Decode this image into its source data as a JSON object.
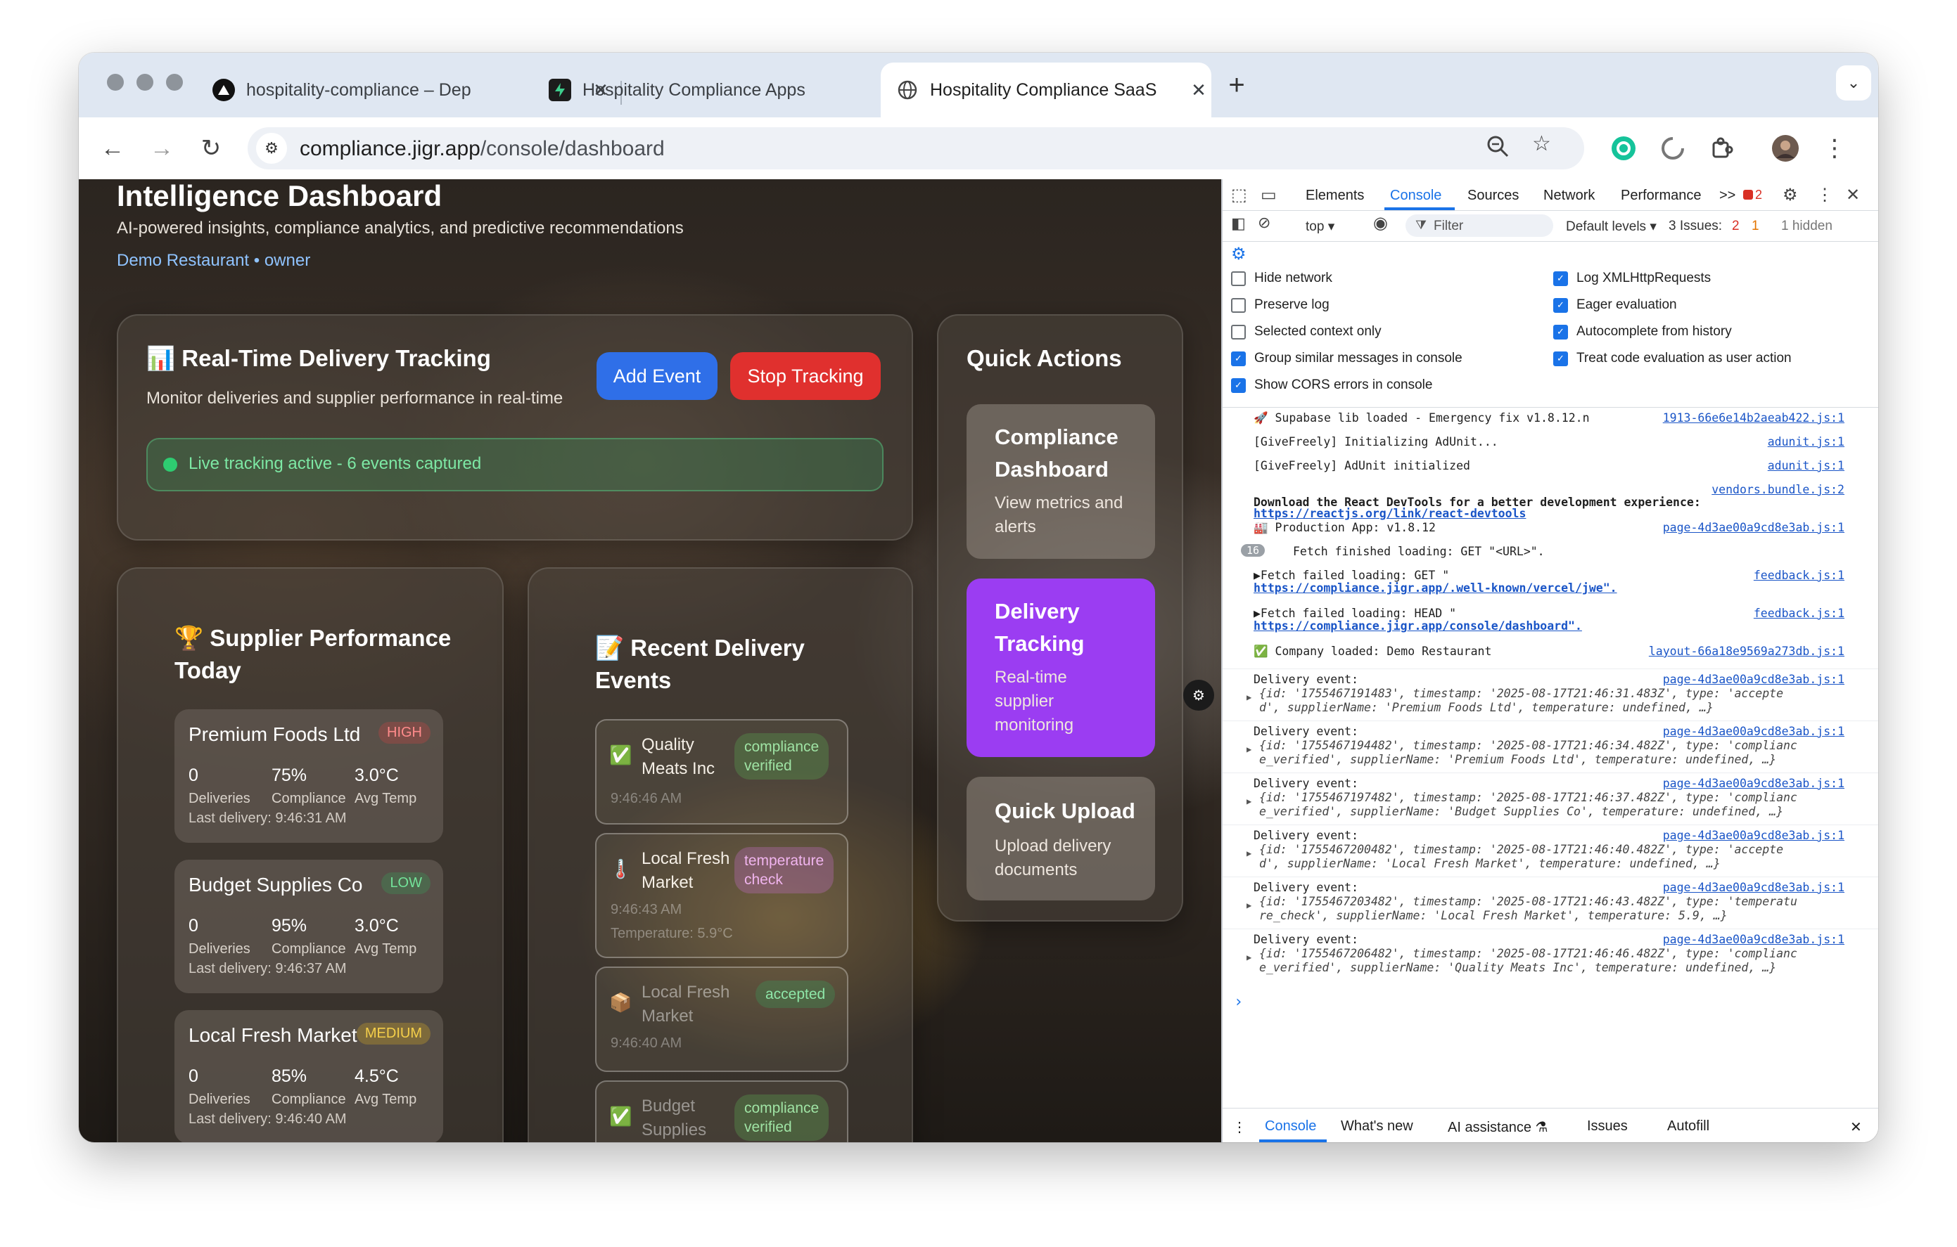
{
  "browser": {
    "tabs": [
      {
        "label": "hospitality-compliance – Dep",
        "icon": "vercel-icon"
      },
      {
        "label": "Hospitality Compliance Apps",
        "icon": "supabase-icon"
      },
      {
        "label": "Hospitality Compliance SaaS",
        "icon": "globe-icon"
      }
    ],
    "new_tab": "+",
    "url_host": "compliance.jigr.app",
    "url_path": "/console/dashboard"
  },
  "page": {
    "title": "Intelligence Dashboard",
    "subtitle": "AI-powered insights, compliance analytics, and predictive recommendations",
    "user_line": "Demo Restaurant • owner"
  },
  "tracking": {
    "emoji": "📊",
    "title": "Real-Time Delivery Tracking",
    "subtitle": "Monitor deliveries and supplier performance in real-time",
    "add_button": "Add Event",
    "stop_button": "Stop Tracking",
    "status": "Live tracking active - 6 events captured"
  },
  "suppliers": {
    "emoji": "🏆",
    "title_line1": "Supplier Performance",
    "title_line2": "Today",
    "items": [
      {
        "name": "Premium Foods Ltd",
        "badge": "HIGH",
        "deliveries": "0",
        "deliveries_label": "Deliveries",
        "compliance": "75%",
        "compliance_label": "Compliance",
        "temp": "3.0°C",
        "temp_label": "Avg Temp",
        "last": "Last delivery: 9:46:31 AM"
      },
      {
        "name": "Budget Supplies Co",
        "badge": "LOW",
        "deliveries": "0",
        "deliveries_label": "Deliveries",
        "compliance": "95%",
        "compliance_label": "Compliance",
        "temp": "3.0°C",
        "temp_label": "Avg Temp",
        "last": "Last delivery: 9:46:37 AM"
      },
      {
        "name": "Local Fresh Market",
        "badge": "MEDIUM",
        "deliveries": "0",
        "deliveries_label": "Deliveries",
        "compliance": "85%",
        "compliance_label": "Compliance",
        "temp": "4.5°C",
        "temp_label": "Avg Temp",
        "last": "Last delivery: 9:46:40 AM"
      }
    ]
  },
  "events": {
    "emoji": "📝",
    "title_line1": "Recent Delivery",
    "title_line2": "Events",
    "items": [
      {
        "icon": "✅",
        "name_line1": "Quality",
        "name_line2": "Meats Inc",
        "badge_line1": "compliance",
        "badge_line2": "verified",
        "time": "9:46:46 AM",
        "extra": ""
      },
      {
        "icon": "🌡️",
        "name_line1": "Local Fresh",
        "name_line2": "Market",
        "badge_line1": "temperature",
        "badge_line2": "check",
        "time": "9:46:43 AM",
        "extra": "Temperature: 5.9°C"
      },
      {
        "icon": "📦",
        "name_line1": "Local Fresh",
        "name_line2": "Market",
        "badge_line1": "accepted",
        "badge_line2": "",
        "time": "9:46:40 AM",
        "extra": ""
      },
      {
        "icon": "✅",
        "name_line1": "Budget",
        "name_line2": "Supplies",
        "badge_line1": "compliance",
        "badge_line2": "verified",
        "time": "",
        "extra": ""
      }
    ]
  },
  "quick_actions": {
    "title": "Quick Actions",
    "items": [
      {
        "title_line1": "Compliance",
        "title_line2": "Dashboard",
        "desc_line1": "View metrics and",
        "desc_line2": "alerts",
        "desc_line3": ""
      },
      {
        "title_line1": "Delivery",
        "title_line2": "Tracking",
        "desc_line1": "Real-time",
        "desc_line2": "supplier",
        "desc_line3": "monitoring"
      },
      {
        "title_line1": "Quick Upload",
        "title_line2": "",
        "desc_line1": "Upload delivery",
        "desc_line2": "documents",
        "desc_line3": ""
      }
    ]
  },
  "devtools": {
    "tabs": [
      "Elements",
      "Console",
      "Sources",
      "Network",
      "Performance"
    ],
    "more": ">>",
    "error_count": "2",
    "context": "top ▾",
    "filter_placeholder": "Filter",
    "levels": "Default levels ▾",
    "issues_label": "3 Issues:",
    "issues_err": "2",
    "issues_warn": "1",
    "hidden": "1 hidden",
    "settings_left": [
      {
        "label": "Hide network",
        "checked": false
      },
      {
        "label": "Preserve log",
        "checked": false
      },
      {
        "label": "Selected context only",
        "checked": false
      },
      {
        "label": "Group similar messages in console",
        "checked": true
      },
      {
        "label": "Show CORS errors in console",
        "checked": true
      }
    ],
    "settings_right": [
      {
        "label": "Log XMLHttpRequests",
        "checked": true
      },
      {
        "label": "Eager evaluation",
        "checked": true
      },
      {
        "label": "Autocomplete from history",
        "checked": true
      },
      {
        "label": "Treat code evaluation as user action",
        "checked": true
      }
    ],
    "logs": [
      {
        "text": "🚀 Supabase lib loaded - Emergency fix v1.8.12.n",
        "src": "1913-66e6e14b2aeab422.js:1"
      },
      {
        "text": "[GiveFreely] Initializing AdUnit...",
        "src": "adunit.js:1"
      },
      {
        "text": "[GiveFreely] AdUnit initialized",
        "src": "adunit.js:1"
      },
      {
        "text": "",
        "src": "vendors.bundle.js:2"
      },
      {
        "text": "Download the React DevTools for a better development experience:",
        "src": ""
      },
      {
        "text": "https://reactjs.org/link/react-devtools",
        "src": ""
      },
      {
        "text": "🏭 Production App: v1.8.12",
        "src": "page-4d3ae00a9cd8e3ab.js:1"
      },
      {
        "text": "Fetch finished loading: GET \"<URL>\".",
        "src": "",
        "count": "16"
      },
      {
        "text": "▶Fetch failed loading: GET \"",
        "src": "feedback.js:1"
      },
      {
        "text": "https://compliance.jigr.app/.well-known/vercel/jwe\".",
        "src": ""
      },
      {
        "text": "▶Fetch failed loading: HEAD \"",
        "src": "feedback.js:1"
      },
      {
        "text": "https://compliance.jigr.app/console/dashboard\".",
        "src": ""
      },
      {
        "text": "✅ Company loaded: Demo Restaurant",
        "src": "layout-66a18e9569a273db.js:1"
      }
    ],
    "delivery_events": [
      {
        "head": "Delivery event:",
        "src": "page-4d3ae00a9cd8e3ab.js:1",
        "line1": "{id: '1755467191483', timestamp: '2025-08-17T21:46:31.483Z', type: 'accepte",
        "line2": "d', supplierName: 'Premium Foods Ltd', temperature: undefined, …}"
      },
      {
        "head": "Delivery event:",
        "src": "page-4d3ae00a9cd8e3ab.js:1",
        "line1": "{id: '1755467194482', timestamp: '2025-08-17T21:46:34.482Z', type: 'complianc",
        "line2": "e_verified', supplierName: 'Premium Foods Ltd', temperature: undefined, …}"
      },
      {
        "head": "Delivery event:",
        "src": "page-4d3ae00a9cd8e3ab.js:1",
        "line1": "{id: '1755467197482', timestamp: '2025-08-17T21:46:37.482Z', type: 'complianc",
        "line2": "e_verified', supplierName: 'Budget Supplies Co', temperature: undefined, …}"
      },
      {
        "head": "Delivery event:",
        "src": "page-4d3ae00a9cd8e3ab.js:1",
        "line1": "{id: '1755467200482', timestamp: '2025-08-17T21:46:40.482Z', type: 'accepte",
        "line2": "d', supplierName: 'Local Fresh Market', temperature: undefined, …}"
      },
      {
        "head": "Delivery event:",
        "src": "page-4d3ae00a9cd8e3ab.js:1",
        "line1": "{id: '1755467203482', timestamp: '2025-08-17T21:46:43.482Z', type: 'temperatu",
        "line2": "re_check', supplierName: 'Local Fresh Market', temperature: 5.9, …}"
      },
      {
        "head": "Delivery event:",
        "src": "page-4d3ae00a9cd8e3ab.js:1",
        "line1": "{id: '1755467206482', timestamp: '2025-08-17T21:46:46.482Z', type: 'complianc",
        "line2": "e_verified', supplierName: 'Quality Meats Inc', temperature: undefined, …}"
      }
    ],
    "prompt": "›",
    "drawer_tabs": [
      "Console",
      "What's new",
      "AI assistance ⚗",
      "Issues",
      "Autofill"
    ]
  }
}
